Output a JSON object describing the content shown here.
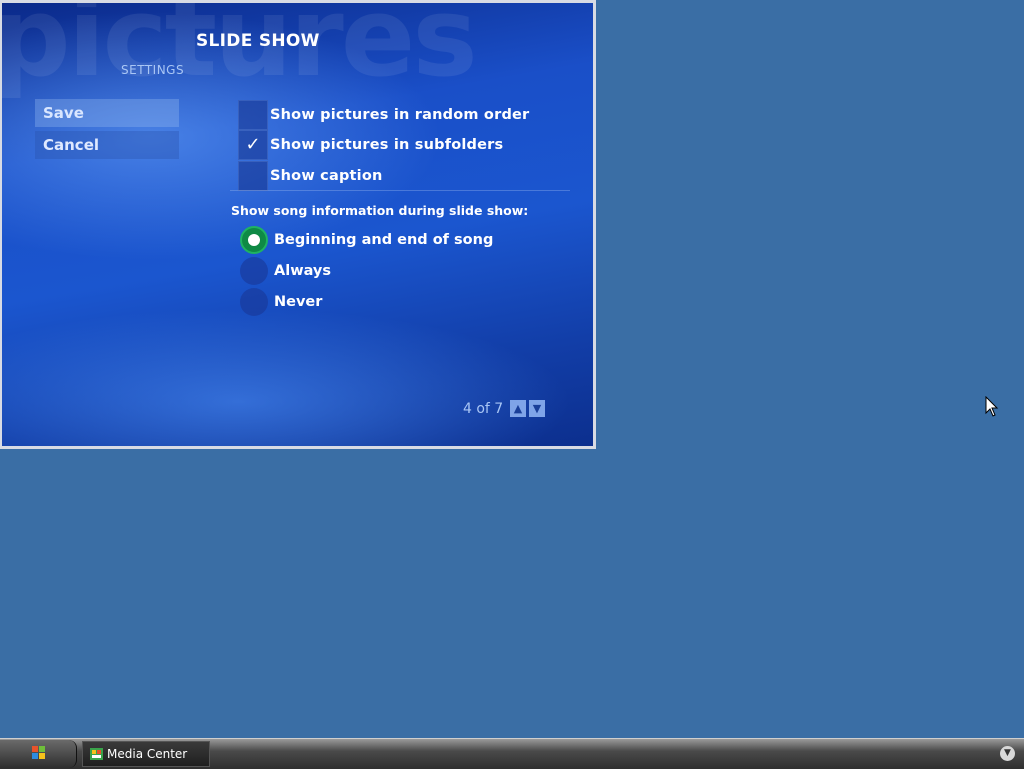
{
  "window": {
    "background_word": "pictures",
    "title": "SLIDE SHOW",
    "subtitle": "SETTINGS"
  },
  "actions": {
    "save_label": "Save",
    "cancel_label": "Cancel"
  },
  "checkboxes": [
    {
      "label": "Show pictures in random order",
      "checked": false
    },
    {
      "label": "Show pictures in subfolders",
      "checked": true
    },
    {
      "label": "Show caption",
      "checked": false
    }
  ],
  "song_info": {
    "label": "Show song information during slide show:",
    "options": [
      {
        "label": "Beginning and end of song",
        "selected": true
      },
      {
        "label": "Always",
        "selected": false
      },
      {
        "label": "Never",
        "selected": false
      }
    ]
  },
  "pager": {
    "text": "4 of 7",
    "up_icon": "arrow-up-icon",
    "down_icon": "arrow-down-icon"
  },
  "check_mark": "✓",
  "taskbar": {
    "task_label": "Media Center"
  },
  "colors": {
    "desktop": "#3a6ea5",
    "radio_selected": "#0f8a45"
  }
}
